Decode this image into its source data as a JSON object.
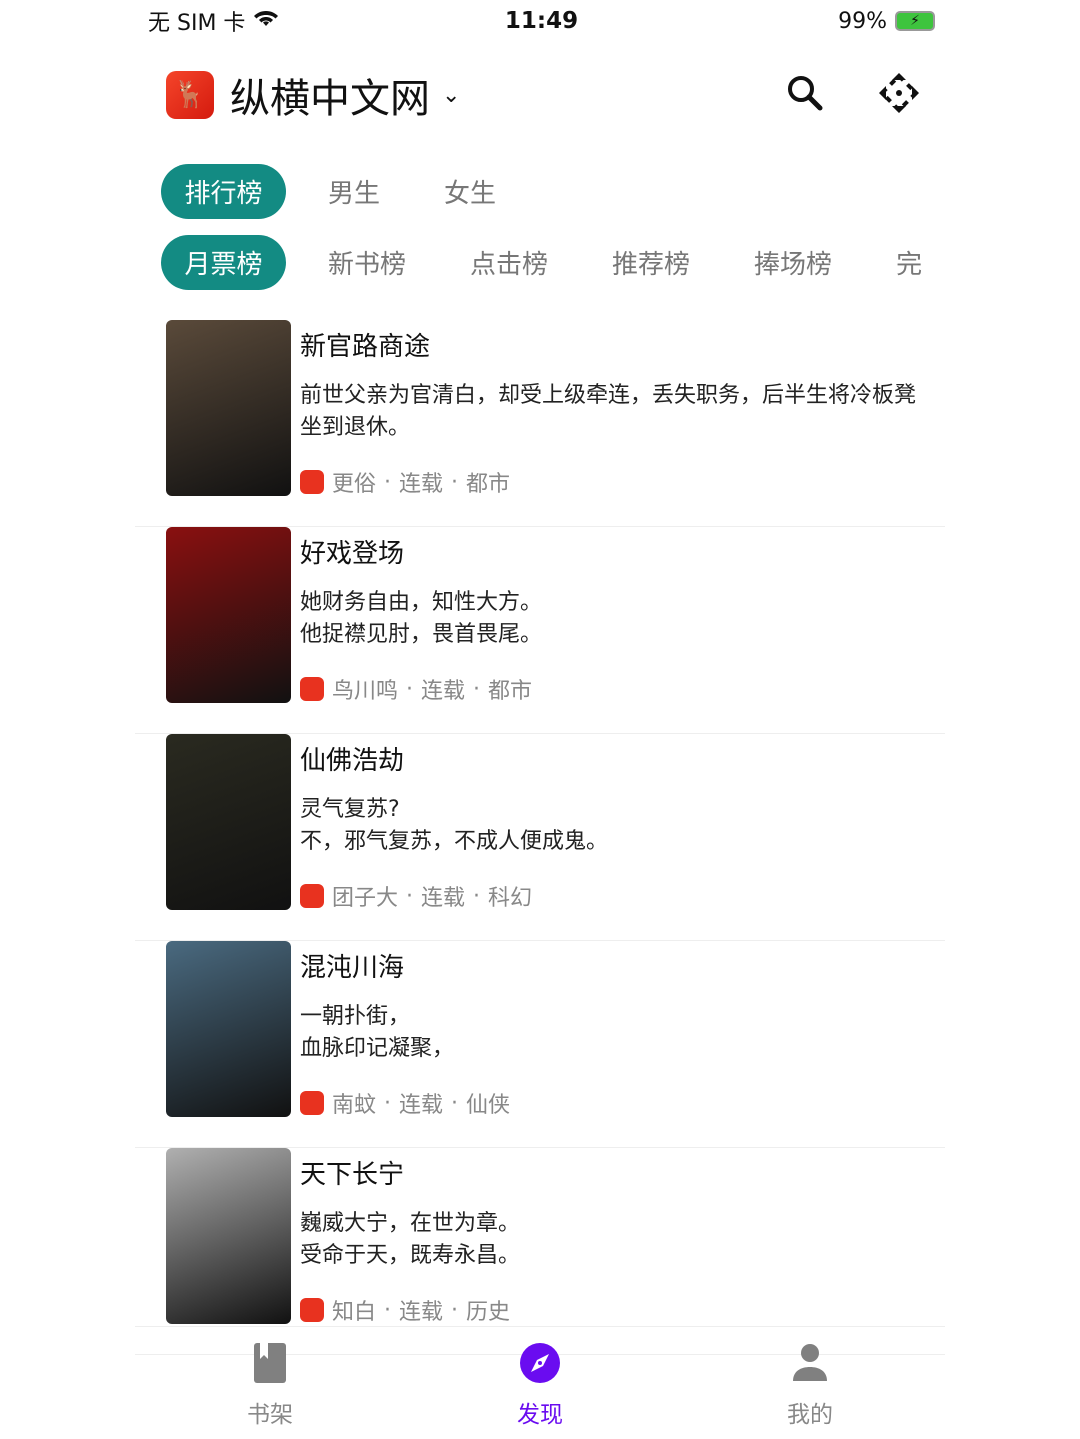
{
  "status": {
    "carrier": "无 SIM 卡",
    "time": "11:49",
    "battery": "99%"
  },
  "header": {
    "title": "纵横中文网",
    "logo_icon": "deer-logo",
    "icons": [
      "search-icon",
      "apps-icon"
    ]
  },
  "category_tabs": [
    {
      "label": "排行榜",
      "active": true
    },
    {
      "label": "男生"
    },
    {
      "label": "女生"
    }
  ],
  "rank_tabs": [
    {
      "label": "月票榜",
      "active": true
    },
    {
      "label": "新书榜"
    },
    {
      "label": "点击榜"
    },
    {
      "label": "推荐榜"
    },
    {
      "label": "捧场榜"
    },
    {
      "label": "完"
    }
  ],
  "books": [
    {
      "title": "新官路商途",
      "desc": "前世父亲为官清白，却受上级牵连，丢失职务，后半生将冷板凳坐到退休。",
      "author": "更俗",
      "status": "连载",
      "genre": "都市",
      "cover_color": "#5a4a3a"
    },
    {
      "title": "好戏登场",
      "desc": "她财务自由，知性大方。\n他捉襟见肘，畏首畏尾。",
      "author": "鸟川鸣",
      "status": "连载",
      "genre": "都市",
      "cover_color": "#8a1010"
    },
    {
      "title": "仙佛浩劫",
      "desc": "灵气复苏?\n不，邪气复苏，不成人便成鬼。",
      "author": "团子大",
      "status": "连载",
      "genre": "科幻",
      "cover_color": "#2a2a20"
    },
    {
      "title": "混沌川海",
      "desc": "一朝扑街，\n血脉印记凝聚，",
      "author": "南蚊",
      "status": "连载",
      "genre": "仙侠",
      "cover_color": "#4a6a80"
    },
    {
      "title": "天下长宁",
      "desc": "巍威大宁，在世为章。\n受命于天，既寿永昌。",
      "author": "知白",
      "status": "连载",
      "genre": "历史",
      "cover_color": "#b0b0b0"
    }
  ],
  "meta_sep": "·",
  "nav": [
    {
      "label": "书架",
      "icon": "bookshelf-icon"
    },
    {
      "label": "发现",
      "icon": "compass-icon",
      "active": true
    },
    {
      "label": "我的",
      "icon": "user-icon"
    }
  ],
  "colors": {
    "accent": "#138b83",
    "nav_active": "#6a0cf0"
  }
}
